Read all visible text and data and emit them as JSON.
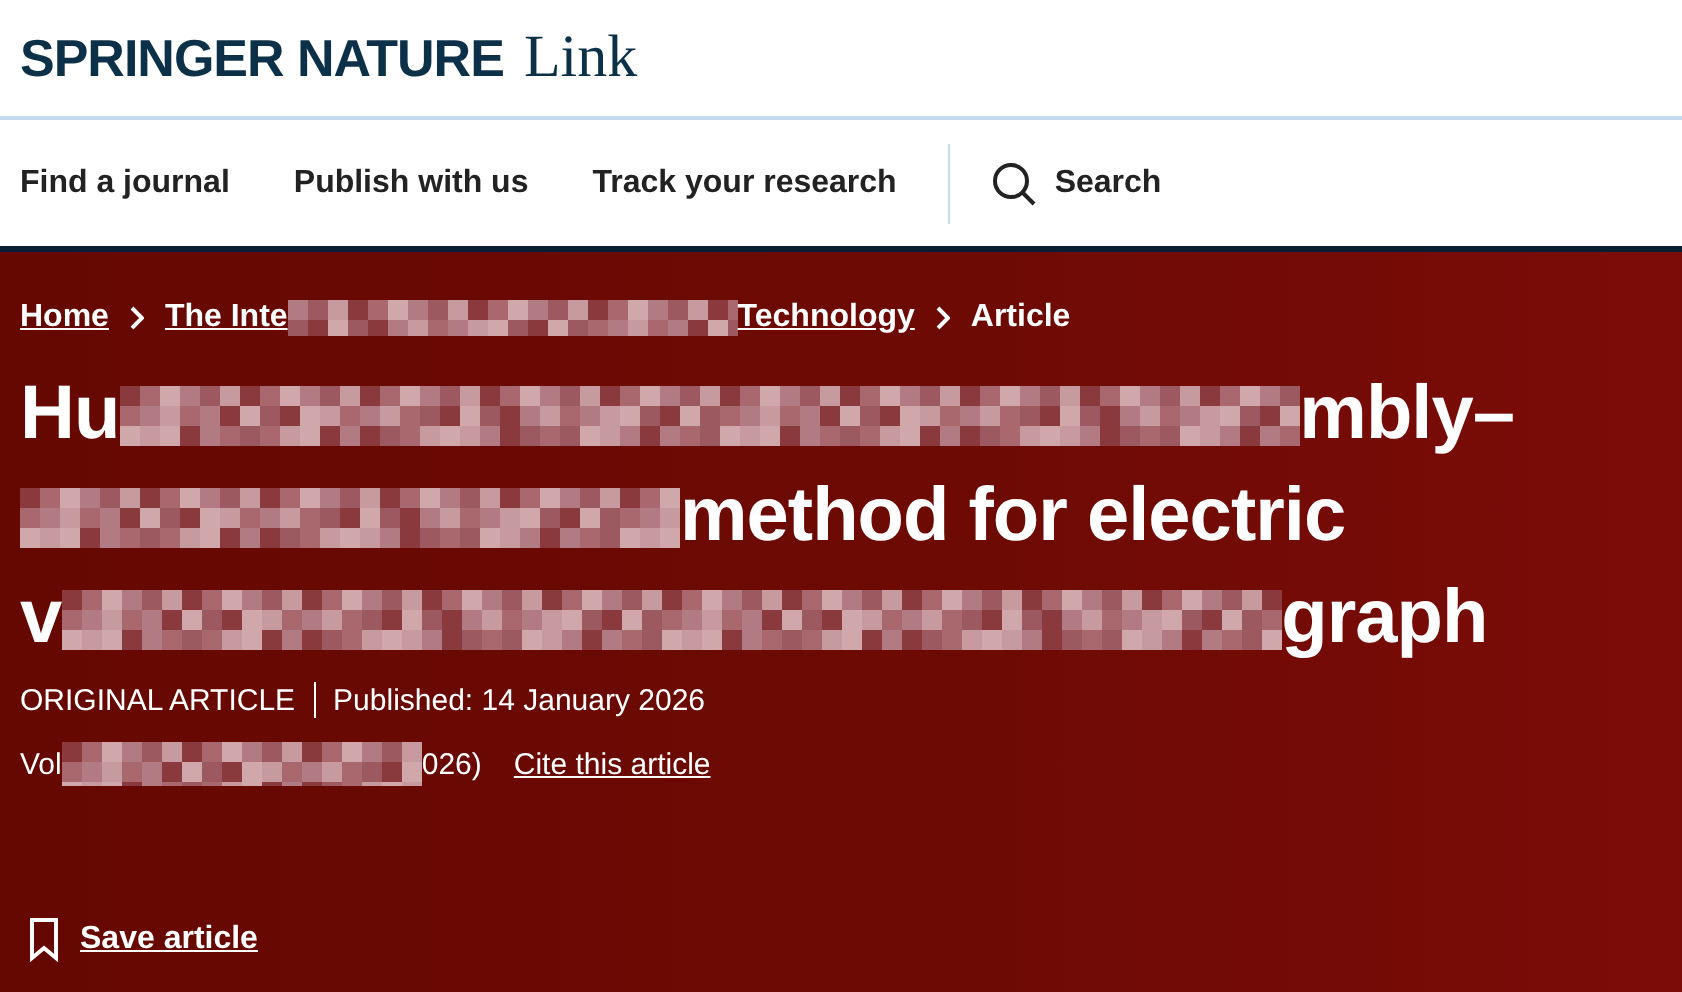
{
  "brand": {
    "name": "SPRINGER NATURE",
    "product": "Link"
  },
  "nav": [
    {
      "label": "Find a journal"
    },
    {
      "label": "Publish with us"
    },
    {
      "label": "Track your research"
    }
  ],
  "search": {
    "label": "Search"
  },
  "breadcrumb": [
    {
      "kind": "link",
      "parts": [
        {
          "kind": "text",
          "text": "Home"
        }
      ]
    },
    {
      "kind": "link",
      "parts": [
        {
          "kind": "text",
          "text": "The Inte"
        },
        {
          "kind": "redacted"
        },
        {
          "kind": "text",
          "text": "Technology"
        }
      ]
    },
    {
      "kind": "current",
      "text": "Article"
    }
  ],
  "title_lines": [
    [
      {
        "kind": "text",
        "text": "Hu"
      },
      {
        "kind": "redacted"
      },
      {
        "kind": "text",
        "text": "mbly–"
      }
    ],
    [
      {
        "kind": "redacted"
      },
      {
        "kind": "text",
        "text": "method for electric"
      }
    ],
    [
      {
        "kind": "text",
        "text": "v"
      },
      {
        "kind": "redacted"
      },
      {
        "kind": "text",
        "text": "graph"
      }
    ]
  ],
  "article_type": "ORIGINAL ARTICLE",
  "published": "Published: 14 January 2026",
  "volume": [
    {
      "kind": "text",
      "text": "Vol"
    },
    {
      "kind": "redacted"
    },
    {
      "kind": "text",
      "text": "026)"
    }
  ],
  "cite_link": "Cite this article",
  "save_label": "Save article"
}
